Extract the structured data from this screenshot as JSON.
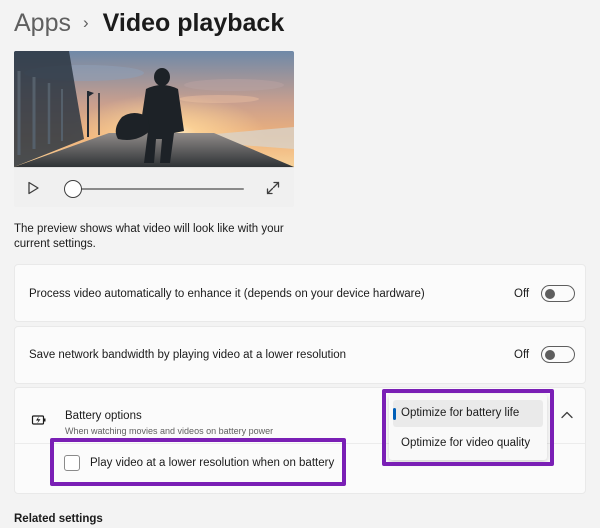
{
  "breadcrumb": {
    "parent": "Apps",
    "separator": "›",
    "title": "Video playback"
  },
  "video_preview": {
    "progress": 0.0
  },
  "preview_caption": "The preview shows what video will look like with your current settings.",
  "settings": [
    {
      "label": "Process video automatically to enhance it (depends on your device hardware)",
      "state": "Off"
    },
    {
      "label": "Save network bandwidth by playing video at a lower resolution",
      "state": "Off"
    }
  ],
  "battery_options": {
    "title": "Battery options",
    "subtitle": "When watching movies and videos on battery power",
    "dropdown_options": [
      "Optimize for battery life",
      "Optimize for video quality"
    ],
    "selected_option": "Optimize for battery life",
    "checkbox_label": "Play video at a lower resolution when on battery",
    "checkbox_checked": false
  },
  "related_settings_heading": "Related settings",
  "colors": {
    "page_background": "#f3f3f3",
    "card_background": "#fbfbfb",
    "accent": "#005fb8",
    "annotation_highlight": "#7a1fb5"
  },
  "icons": [
    "play-icon",
    "fullscreen-icon",
    "battery-saver-icon",
    "chevron-up-icon"
  ]
}
